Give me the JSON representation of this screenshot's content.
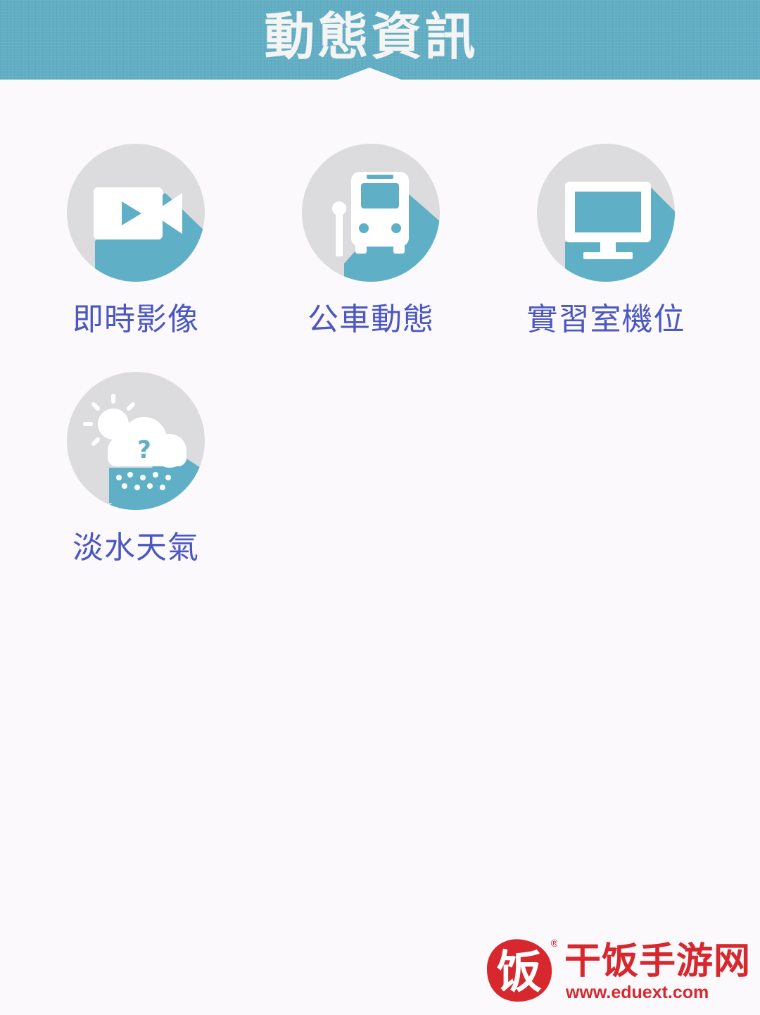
{
  "header": {
    "title": "動態資訊"
  },
  "menu": {
    "items": [
      {
        "label": "即時影像",
        "icon": "video-camera-icon"
      },
      {
        "label": "公車動態",
        "icon": "bus-icon"
      },
      {
        "label": "實習室機位",
        "icon": "monitor-icon"
      },
      {
        "label": "淡水天氣",
        "icon": "weather-icon"
      }
    ]
  },
  "watermark": {
    "glyph": "饭",
    "name": "干饭手游网",
    "url": "www.eduext.com",
    "registered": "®"
  },
  "colors": {
    "header": "#62aec4",
    "accent": "#5fb0c6",
    "circle": "#dcdcdf",
    "label": "#4b57c2",
    "background": "#fcf9fd",
    "watermark": "#d6282d"
  }
}
